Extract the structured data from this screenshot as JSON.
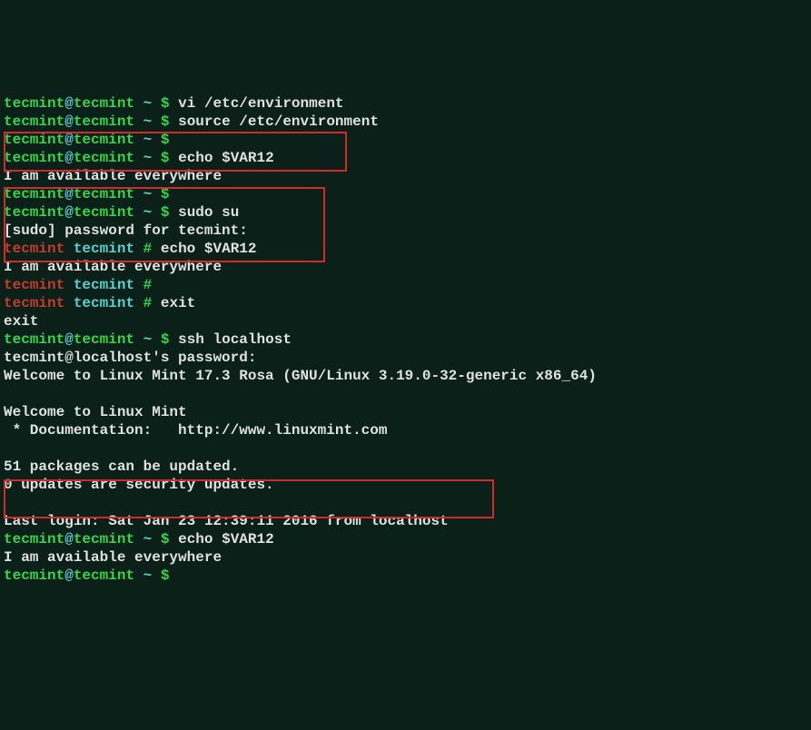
{
  "prompt": {
    "user": "tecmint",
    "at": "@",
    "host": "tecmint",
    "sep1": " ",
    "tilde": "~",
    "sep2": " ",
    "dollar": "$",
    "sp": " ",
    "root_hash": "#",
    "root_user": "tecmint",
    "root_host": "tecmint",
    "localhost": "localhost"
  },
  "cmd": {
    "vi": "vi /etc/environment",
    "source": "source /etc/environment",
    "echo": "echo $VAR12",
    "sudo": "sudo su",
    "exit": "exit",
    "ssh": "ssh localhost"
  },
  "out": {
    "avail": "I am available everywhere",
    "sudo_prompt": "[sudo] password for tecmint:",
    "exit_literal": "exit",
    "ssh_pw": "tecmint@localhost's password:",
    "welcome_full": "Welcome to Linux Mint 17.3 Rosa (GNU/Linux 3.19.0-32-generic x86_64)",
    "welcome_short": "Welcome to Linux Mint",
    "docs": " * Documentation:   http://www.linuxmint.com",
    "pkg": "51 packages can be updated.",
    "sec": "0 updates are security updates.",
    "last": "Last login: Sat Jan 23 12:39:11 2016 from localhost"
  }
}
